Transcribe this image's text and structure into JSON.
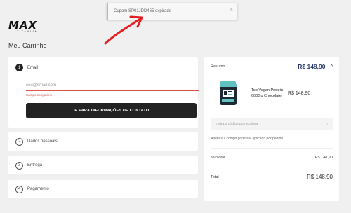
{
  "brand": {
    "logo_text": "MAX",
    "logo_sub": "TITANIUM"
  },
  "toast": {
    "message": "Cupom SP01JDD465 expirado",
    "close_label": "×"
  },
  "page": {
    "title": "Meu Carrinho"
  },
  "email_step": {
    "number": "1",
    "label": "Email",
    "input_placeholder": "seu@email.com",
    "error": "Campo obrigatório",
    "button_label": "IR PARA INFORMAÇÕES DE CONTATO"
  },
  "steps": [
    {
      "number": "2",
      "label": "Dados pessoais"
    },
    {
      "number": "3",
      "label": "Entrega"
    },
    {
      "number": "4",
      "label": "Pagamento"
    }
  ],
  "summary": {
    "title": "Resumo",
    "total_top": "R$ 148,90",
    "caret": "^",
    "product": {
      "name": "Top Vegan Protein 600Gg Chocolate",
      "price": "R$ 148,90"
    },
    "promo_placeholder": "Insira o código promocional",
    "promo_arrow": "›",
    "promo_note": "Apenas 1 código pode ser aplicado por pedido.",
    "subtotal_label": "Subtotal",
    "subtotal_value": "R$ 148,90",
    "total_label": "Total",
    "total_value": "R$ 148,90"
  },
  "colors": {
    "accent": "#2a3a66",
    "error": "#d9534f",
    "annotation_arrow": "#e02020",
    "toast_border": "#f2b433"
  }
}
